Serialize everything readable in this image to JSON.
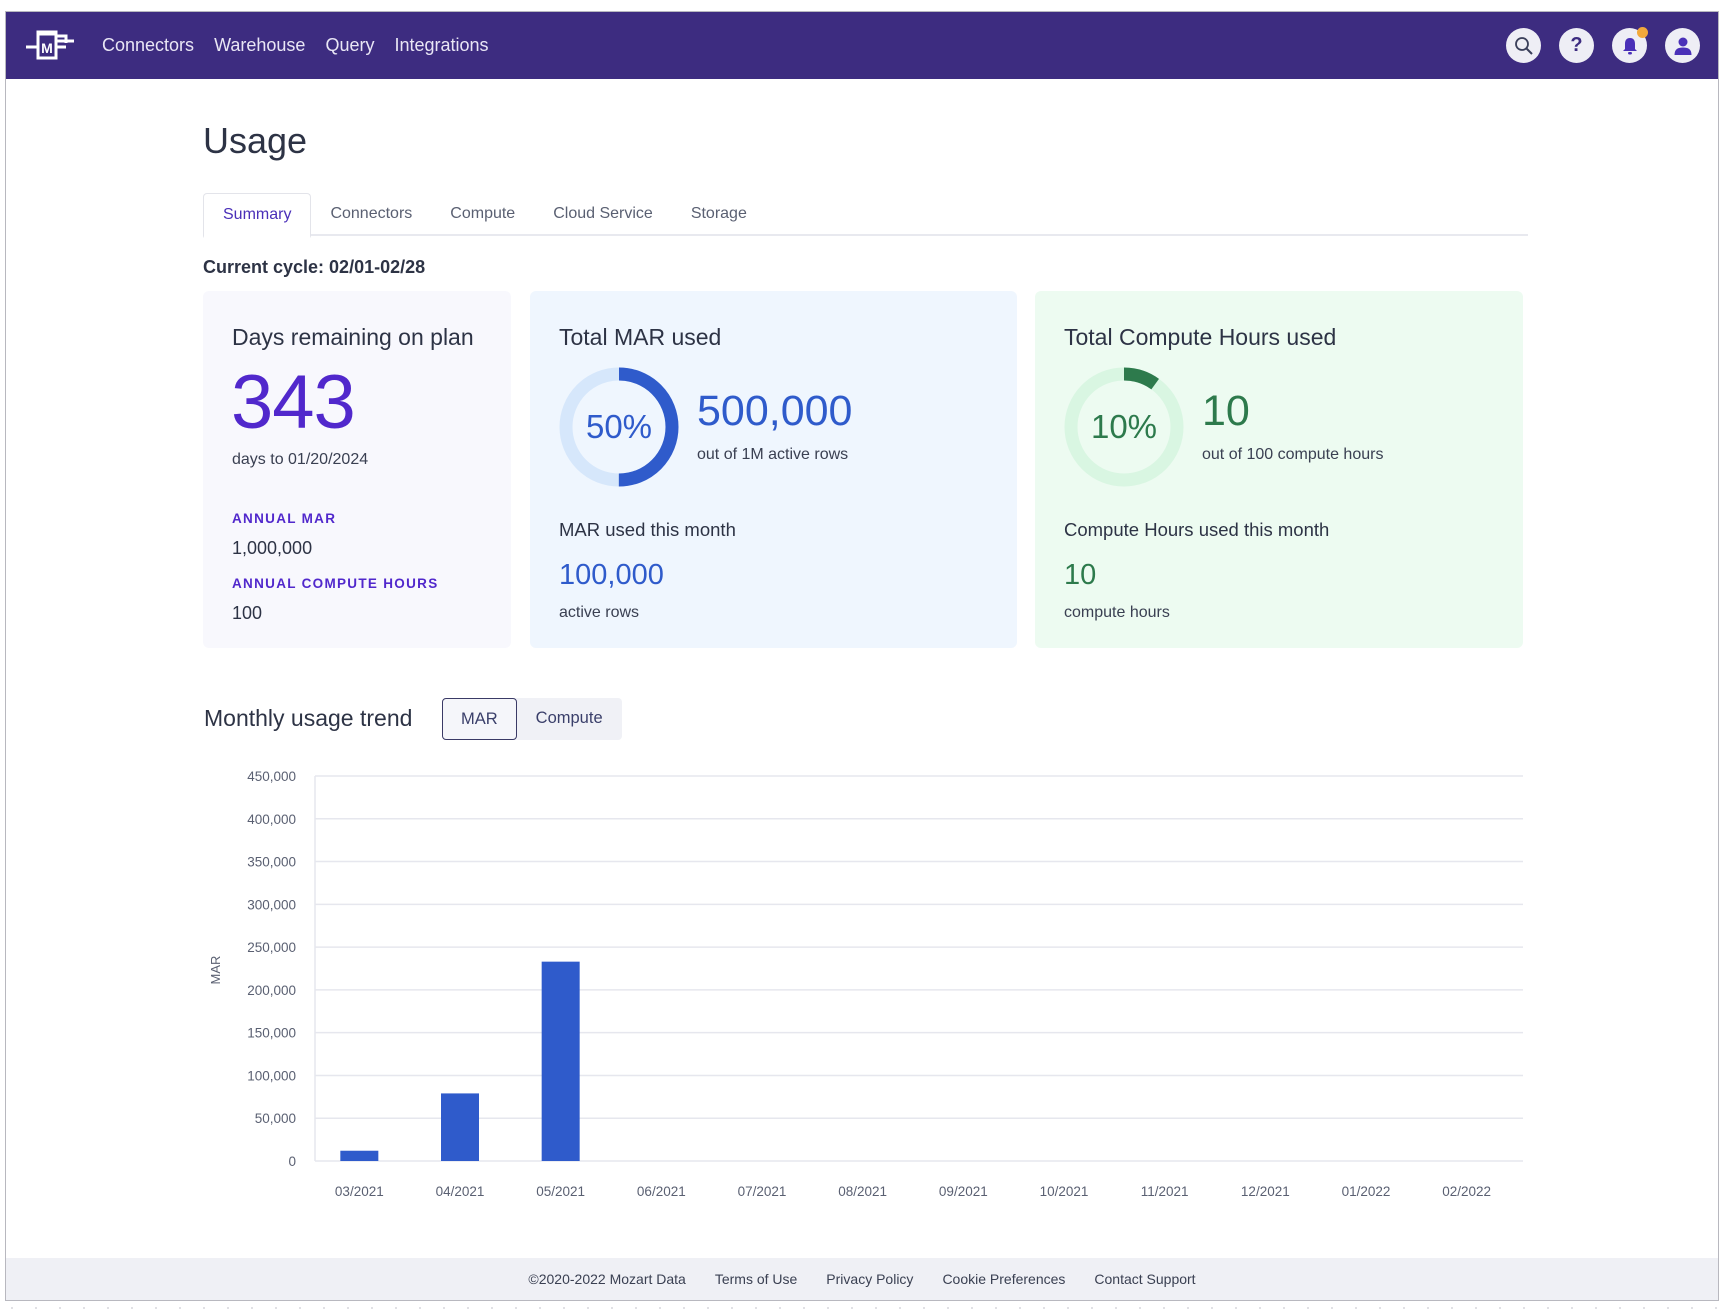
{
  "nav": {
    "logo_letter": "M",
    "links": [
      "Connectors",
      "Warehouse",
      "Query",
      "Integrations"
    ],
    "icons": [
      "search-icon",
      "help-icon",
      "bell-icon",
      "user-icon"
    ],
    "help_glyph": "?"
  },
  "page": {
    "title": "Usage",
    "tabs": [
      "Summary",
      "Connectors",
      "Compute",
      "Cloud Service",
      "Storage"
    ],
    "active_tab": "Summary",
    "cycle": "Current cycle: 02/01-02/28"
  },
  "cards": {
    "days": {
      "title": "Days remaining on plan",
      "value": "343",
      "sub": "days to 01/20/2024",
      "annual_mar_label": "ANNUAL MAR",
      "annual_mar_value": "1,000,000",
      "annual_compute_label": "ANNUAL COMPUTE HOURS",
      "annual_compute_value": "100"
    },
    "mar": {
      "title": "Total MAR used",
      "percent_label": "50%",
      "percent": 0.5,
      "value": "500,000",
      "sub": "out of 1M active rows",
      "month_title": "MAR used this month",
      "month_value": "100,000",
      "month_sub": "active rows",
      "color": "#2f5bcb",
      "track_color": "#d6e7fb"
    },
    "compute": {
      "title": "Total Compute Hours used",
      "percent_label": "10%",
      "percent": 0.1,
      "value": "10",
      "sub": "out of 100 compute hours",
      "month_title": "Compute Hours used this month",
      "month_value": "10",
      "month_sub": "compute hours",
      "color": "#2d7a4c",
      "track_color": "#d9f6e2"
    }
  },
  "trend": {
    "title": "Monthly usage trend",
    "toggle": [
      "MAR",
      "Compute"
    ],
    "active_toggle": "MAR"
  },
  "chart_data": {
    "type": "bar",
    "title": "Monthly usage trend",
    "xlabel": "",
    "ylabel": "MAR",
    "categories": [
      "03/2021",
      "04/2021",
      "05/2021",
      "06/2021",
      "07/2021",
      "08/2021",
      "09/2021",
      "10/2021",
      "11/2021",
      "12/2021",
      "01/2022",
      "02/2022"
    ],
    "values": [
      12000,
      79000,
      233000,
      0,
      0,
      0,
      0,
      0,
      0,
      0,
      0,
      0
    ],
    "ylim": [
      0,
      450000
    ],
    "yticks": [
      0,
      50000,
      100000,
      150000,
      200000,
      250000,
      300000,
      350000,
      400000,
      450000
    ],
    "ytick_labels": [
      "0",
      "50,000",
      "100,000",
      "150,000",
      "200,000",
      "250,000",
      "300,000",
      "350,000",
      "400,000",
      "450,000"
    ],
    "grid": true,
    "bar_color": "#2f5bcb"
  },
  "footer": {
    "copyright": "©2020-2022 Mozart Data",
    "links": [
      "Terms of Use",
      "Privacy Policy",
      "Cookie Preferences",
      "Contact Support"
    ]
  }
}
